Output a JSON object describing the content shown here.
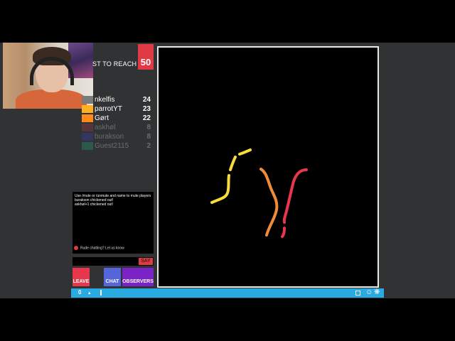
{
  "goal": {
    "label": "ST TO REACH",
    "value": "50",
    "color": "#e03a45"
  },
  "scoreboard": [
    {
      "name": "nkelfis",
      "score": "24",
      "color": "#7a7a7a",
      "active": true
    },
    {
      "name": "parrotYT",
      "score": "23",
      "color": "#ffb020",
      "active": true
    },
    {
      "name": "Gørt",
      "score": "22",
      "color": "#ff8a1a",
      "active": true
    },
    {
      "name": "askhøl",
      "score": "8",
      "color": "#8a3a4a",
      "active": false
    },
    {
      "name": "burakson",
      "score": "8",
      "color": "#3a3a9a",
      "active": false
    },
    {
      "name": "Guest2115",
      "score": "2",
      "color": "#2a8a6a",
      "active": false
    }
  ],
  "chat": {
    "lines": [
      "Use /mute or /unmute and name to mute players",
      "burakson chickened out!",
      "askhøl+1 chickened out!"
    ],
    "warning": "Rude chatting? Let us know",
    "say_label": "SAY"
  },
  "buttons": {
    "leave": "LEAVE",
    "chat": "CHAT",
    "observers": "OBSERVERS"
  },
  "status": {
    "count": "0"
  },
  "trails": [
    {
      "color": "#f7dc3c",
      "segments": 3
    },
    {
      "color": "#f08b3a",
      "segments": 1
    },
    {
      "color": "#e8364d",
      "segments": 2
    }
  ]
}
